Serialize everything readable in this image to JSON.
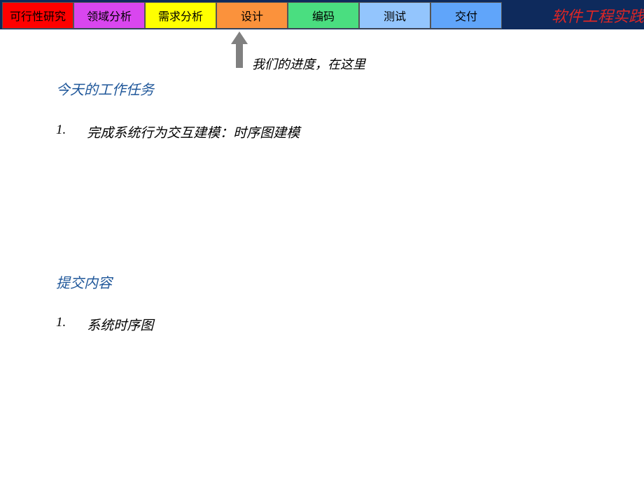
{
  "header": {
    "phases": [
      {
        "label": "可行性研究"
      },
      {
        "label": "领域分析"
      },
      {
        "label": "需求分析"
      },
      {
        "label": "设计"
      },
      {
        "label": "编码"
      },
      {
        "label": "测试"
      },
      {
        "label": "交付"
      }
    ],
    "title": "软件工程实践"
  },
  "progress": {
    "label": "我们的进度，在这里"
  },
  "sections": {
    "tasks": {
      "heading": "今天的工作任务",
      "items": [
        {
          "number": "1.",
          "text": "完成系统行为交互建模：时序图建模"
        }
      ]
    },
    "deliverables": {
      "heading": "提交内容",
      "items": [
        {
          "number": "1.",
          "text": "系统时序图"
        }
      ]
    }
  }
}
